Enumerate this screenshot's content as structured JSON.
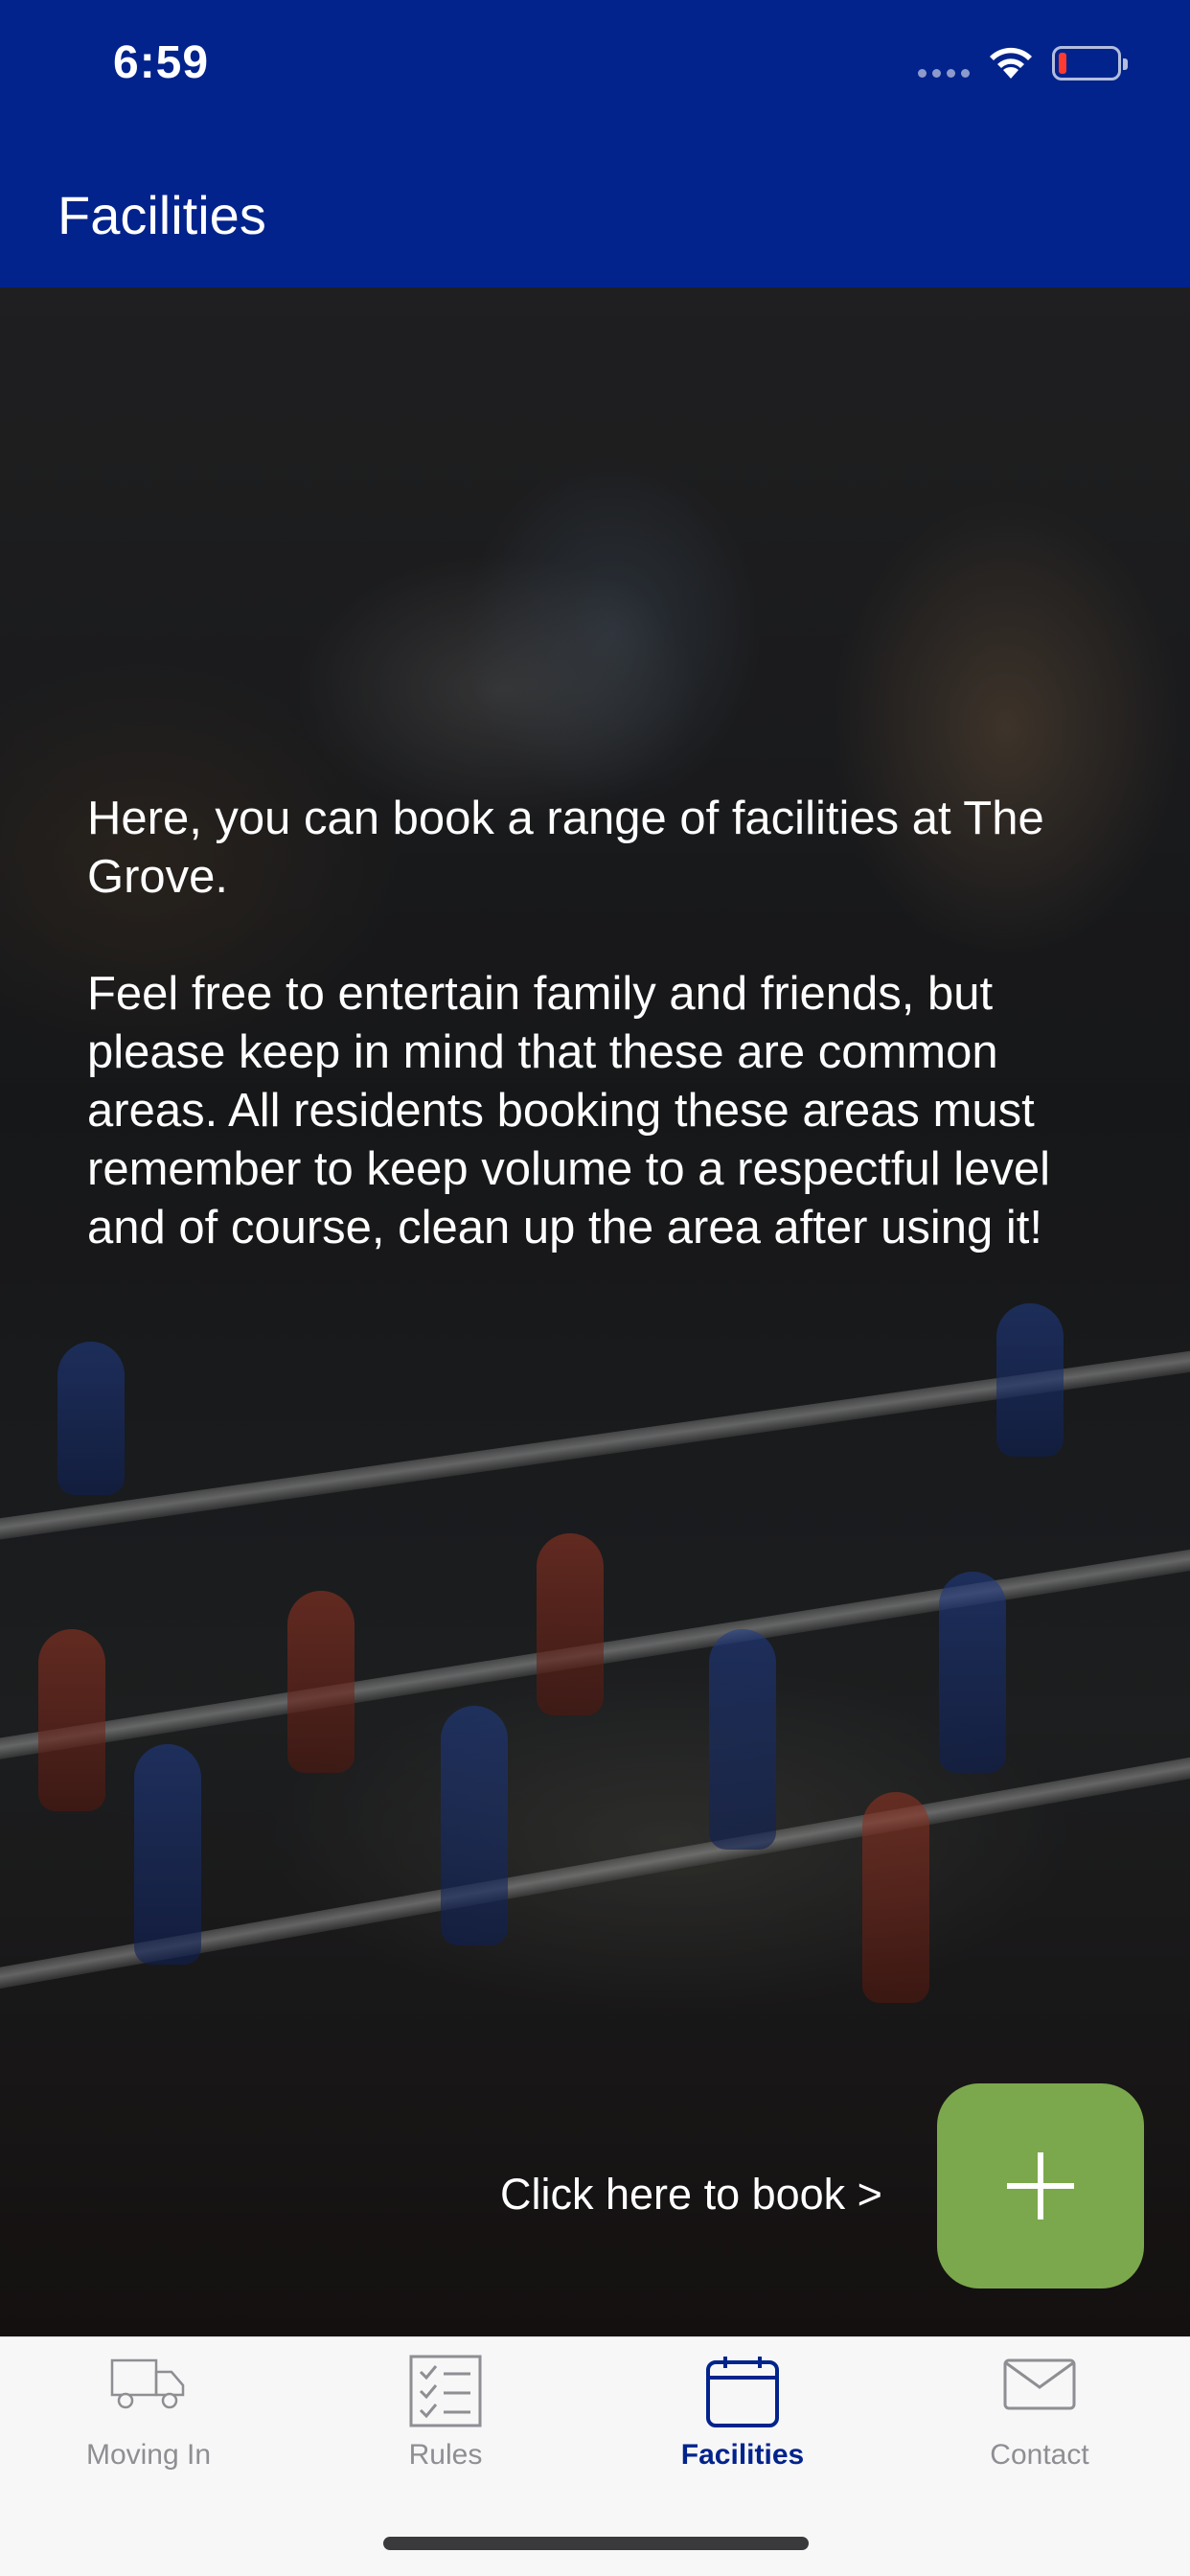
{
  "status_bar": {
    "time": "6:59",
    "battery_color": "#ff3b30"
  },
  "nav": {
    "title": "Facilities",
    "background": "#02238c"
  },
  "intro": {
    "paragraph_1": "Here, you can book a range of facilities at The Grove.",
    "paragraph_2": "Feel free to entertain family and friends, but please keep in mind that these are common areas. All residents booking these areas must remember to keep volume to a respectful level and of course, clean up the area after using it!"
  },
  "booking": {
    "link_label": "Click here to book >",
    "button_icon": "plus-icon",
    "button_color": "#7ba84c"
  },
  "tab_bar": {
    "tabs": [
      {
        "label": "Moving In",
        "icon": "truck-icon",
        "active": false
      },
      {
        "label": "Rules",
        "icon": "checklist-icon",
        "active": false
      },
      {
        "label": "Facilities",
        "icon": "calendar-icon",
        "active": true
      },
      {
        "label": "Contact",
        "icon": "envelope-icon",
        "active": false
      }
    ],
    "active_color": "#02238c",
    "inactive_color": "#8e8e93"
  }
}
